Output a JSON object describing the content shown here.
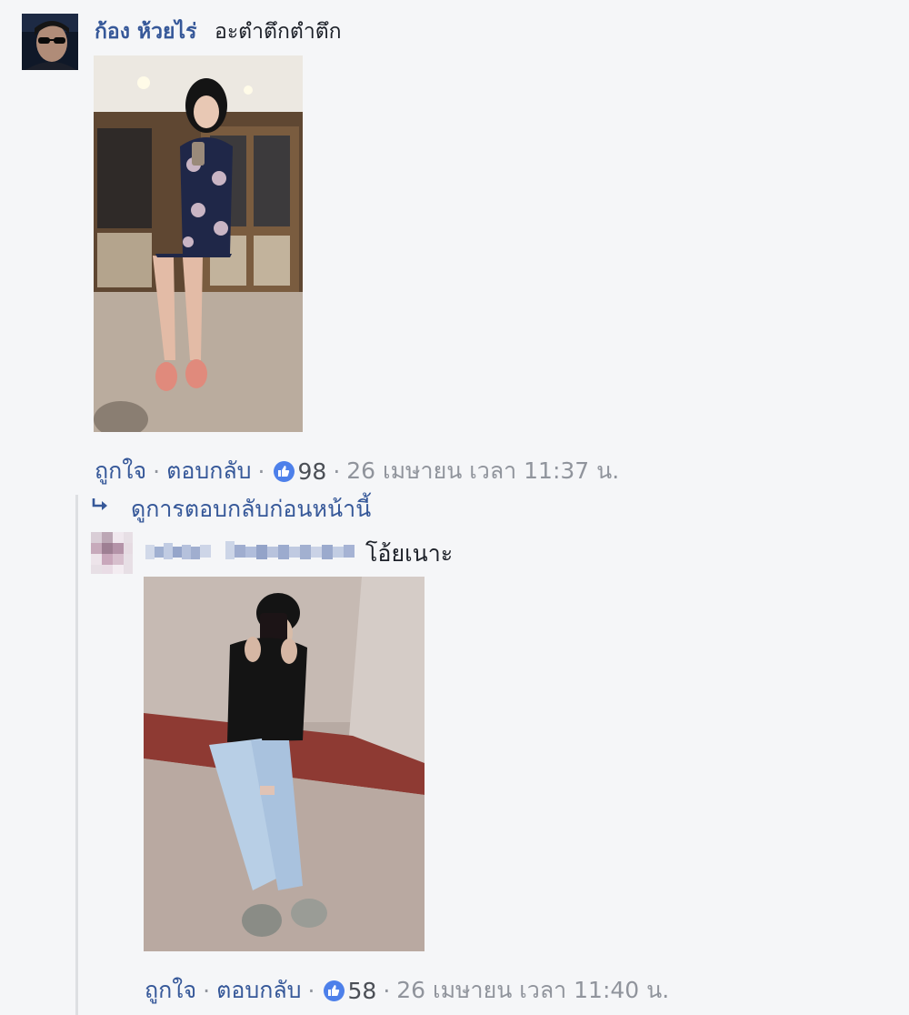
{
  "comments": [
    {
      "author": "ก้อง ห้วยไร่",
      "text": "อะตำตึกตำตึก",
      "like_label": "ถูกใจ",
      "reply_label": "ตอบกลับ",
      "reactions": "98",
      "timestamp": "26 เมษายน เวลา 11:37 น."
    }
  ],
  "view_previous_replies": "ดูการตอบกลับก่อนหน้านี้",
  "reply": {
    "text": "โอ้ยเนาะ",
    "like_label": "ถูกใจ",
    "reply_label": "ตอบกลับ",
    "reactions": "58",
    "timestamp": "26 เมษายน เวลา 11:40 น."
  },
  "separator": "·",
  "colors": {
    "link": "#365899",
    "meta": "#90949c",
    "like_badge": "#4d80ea",
    "background": "#f5f6f8"
  },
  "icons": [
    "thumbs-up-icon",
    "reply-arrow-icon"
  ]
}
